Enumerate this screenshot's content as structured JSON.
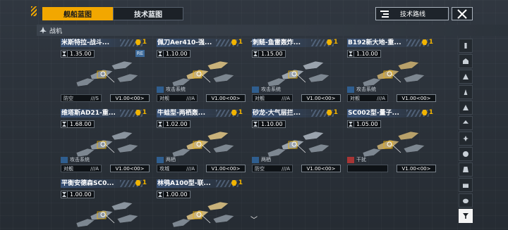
{
  "header": {
    "tabs": [
      {
        "label": "舰船蓝图",
        "active": true
      },
      {
        "label": "技术蓝图",
        "active": false
      }
    ],
    "tech_route_label": "技术路线",
    "close_icon": "close-icon"
  },
  "category": {
    "label": "战机",
    "icon": "fighter-icon"
  },
  "cards": [
    {
      "name": "米斯特拉-战斗...",
      "count": "1",
      "cost": "1.35.00",
      "badge": "RE",
      "system": "",
      "role": "防空",
      "role_grade": "///S",
      "version": "V1.00<00>"
    },
    {
      "name": "佩刀Aer410-强...",
      "count": "1",
      "cost": "1.10.00",
      "badge": "",
      "system": "攻击系统",
      "role": "对舰",
      "role_grade": "///A",
      "version": "V1.00<00>"
    },
    {
      "name": "刺鲢-鱼雷轰炸...",
      "count": "1",
      "cost": "1.15.00",
      "badge": "",
      "system": "攻击系统",
      "role": "对舰",
      "role_grade": "///A",
      "version": "V1.00<00>"
    },
    {
      "name": "B192新大地-重...",
      "count": "1",
      "cost": "1.10.00",
      "badge": "",
      "system": "攻击系统",
      "role": "对舰",
      "role_grade": "///A",
      "version": "V1.00<00>"
    },
    {
      "name": "维塔斯AD21-重...",
      "count": "1",
      "cost": "1.68.00",
      "badge": "",
      "system": "攻击系统",
      "role": "对舰",
      "role_grade": "///A",
      "version": "V1.00<00>"
    },
    {
      "name": "牛蛙型-两栖轰...",
      "count": "1",
      "cost": "1.02.00",
      "badge": "",
      "system": "两栖",
      "role": "攻城",
      "role_grade": "///A",
      "version": "V1.00<00>"
    },
    {
      "name": "砂龙-大气层拦...",
      "count": "1",
      "cost": "1.10.00",
      "badge": "",
      "system": "两栖",
      "role": "防空",
      "role_grade": "///A",
      "version": "V1.00<00>"
    },
    {
      "name": "SC002型-量子...",
      "count": "1",
      "cost": "1.05.00",
      "badge": "",
      "system": "干扰",
      "role": "",
      "role_grade": "",
      "version": "V1.00<00>"
    },
    {
      "name": "平衡安德森SC0...",
      "count": "1",
      "cost": "1.00.00",
      "badge": "",
      "system": "",
      "role": "",
      "role_grade": "",
      "version": ""
    },
    {
      "name": "林鸮A100型-联...",
      "count": "1",
      "cost": "1.00.00",
      "badge": "",
      "system": "",
      "role": "",
      "role_grade": "",
      "version": ""
    }
  ],
  "rail": [
    {
      "icon": "carrier-icon"
    },
    {
      "icon": "battleship-icon"
    },
    {
      "icon": "cruiser-icon"
    },
    {
      "icon": "destroyer-icon"
    },
    {
      "icon": "frigate-icon"
    },
    {
      "icon": "corvette-icon"
    },
    {
      "icon": "fighter-class-icon"
    },
    {
      "icon": "squadron-icon"
    },
    {
      "icon": "hangar-icon"
    },
    {
      "icon": "module-icon"
    },
    {
      "icon": "dome-icon"
    },
    {
      "icon": "filter-icon"
    }
  ],
  "colors": {
    "accent": "#f2a700",
    "count": "#f2b400",
    "system_blue": "#2f5e8f",
    "system_red": "#a73535"
  }
}
